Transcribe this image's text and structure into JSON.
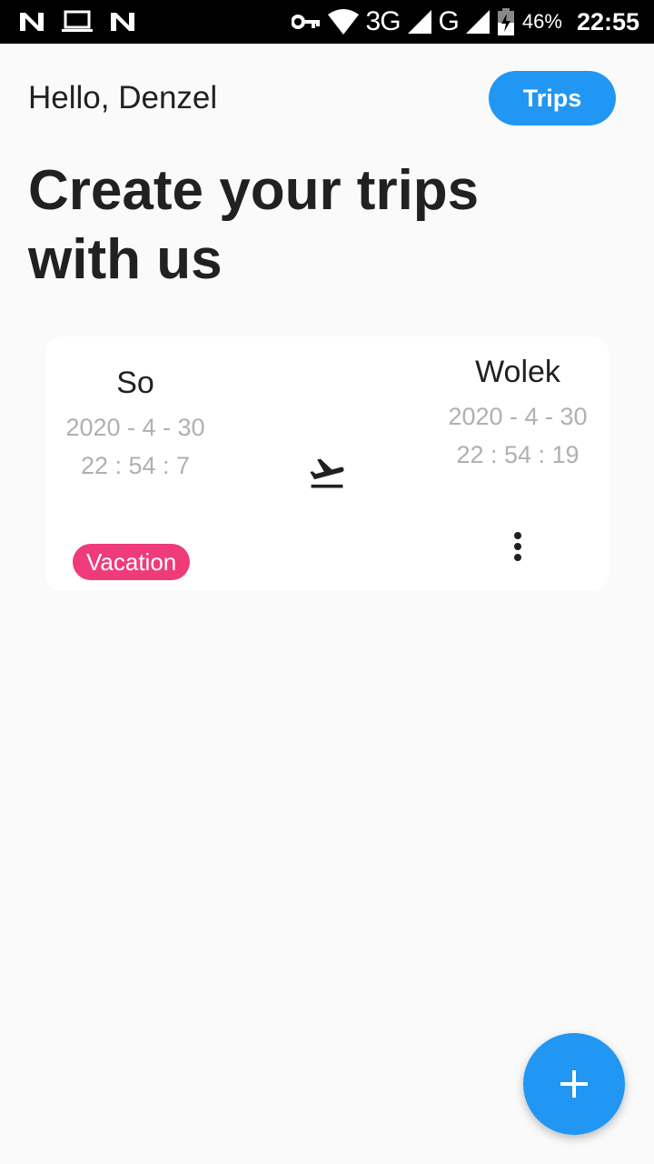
{
  "status_bar": {
    "network_3g": "3G",
    "network_g": "G",
    "battery_percent": "46%",
    "time": "22:55",
    "icons": [
      "n-notification-icon",
      "laptop-icon",
      "n-notification-icon",
      "key-icon",
      "wifi-icon",
      "signal-icon",
      "battery-icon"
    ]
  },
  "header": {
    "greeting": "Hello, Denzel",
    "trips_button": "Trips",
    "headline": "Create your trips with us"
  },
  "trips": [
    {
      "from": {
        "city": "So",
        "date": "2020 - 4 - 30",
        "time": "22 : 54 : 7"
      },
      "to": {
        "city": "Wolek",
        "date": "2020 - 4 - 30",
        "time": "22 : 54 : 19"
      },
      "tag": "Vacation",
      "tag_color": "#ef3b7a",
      "transport_icon": "flight-takeoff-icon",
      "menu_icon": "more-vert-icon"
    }
  ],
  "fab": {
    "icon": "plus-icon"
  },
  "colors": {
    "accent": "#2196f3",
    "background": "#fafafa",
    "card": "#ffffff",
    "muted_text": "#b0b0b0"
  }
}
